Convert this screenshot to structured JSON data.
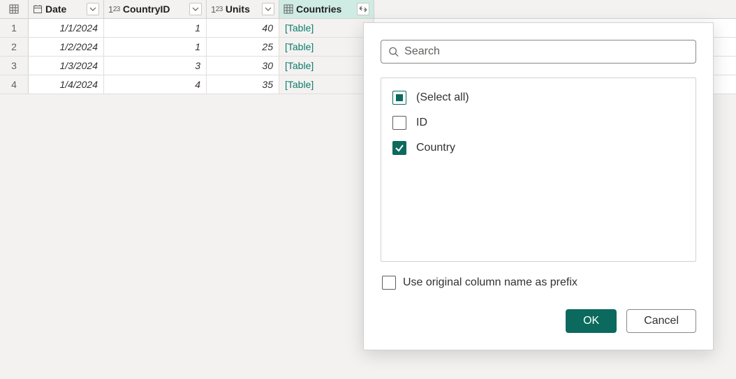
{
  "columns": {
    "date": {
      "label": "Date"
    },
    "countryid": {
      "label": "CountryID"
    },
    "units": {
      "label": "Units"
    },
    "countries": {
      "label": "Countries"
    }
  },
  "rows": [
    {
      "num": "1",
      "date": "1/1/2024",
      "countryid": "1",
      "units": "40",
      "countries": "[Table]"
    },
    {
      "num": "2",
      "date": "1/2/2024",
      "countryid": "1",
      "units": "25",
      "countries": "[Table]"
    },
    {
      "num": "3",
      "date": "1/3/2024",
      "countryid": "3",
      "units": "30",
      "countries": "[Table]"
    },
    {
      "num": "4",
      "date": "1/4/2024",
      "countryid": "4",
      "units": "35",
      "countries": "[Table]"
    }
  ],
  "popup": {
    "search_placeholder": "Search",
    "items": [
      {
        "label": "(Select all)",
        "state": "indeterminate"
      },
      {
        "label": "ID",
        "state": "unchecked"
      },
      {
        "label": "Country",
        "state": "checked"
      }
    ],
    "prefix_label": "Use original column name as prefix",
    "ok_label": "OK",
    "cancel_label": "Cancel"
  }
}
